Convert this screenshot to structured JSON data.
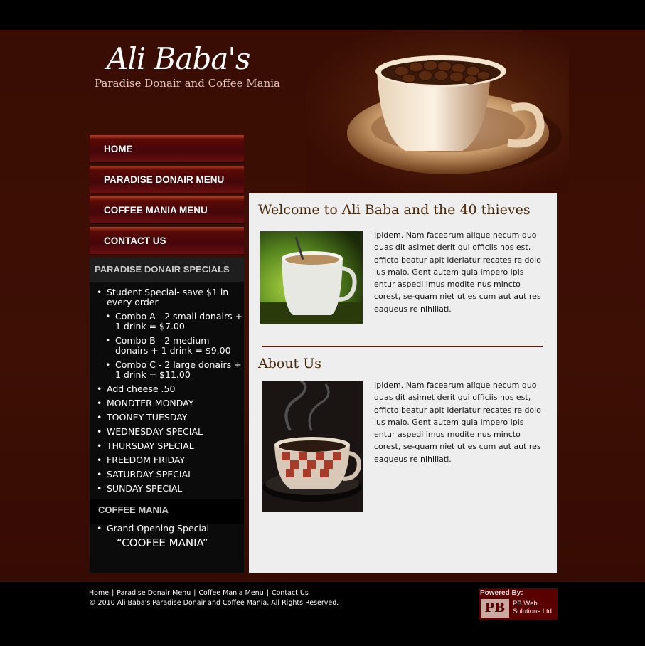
{
  "header": {
    "logo": "Ali Baba's",
    "tagline": "Paradise Donair and Coffee Mania"
  },
  "nav": {
    "items": [
      {
        "label": "HOME"
      },
      {
        "label": "PARADISE DONAIR MENU"
      },
      {
        "label": "COFFEE MANIA MENU"
      },
      {
        "label": "CONTACT US"
      }
    ]
  },
  "sidebar": {
    "donair_title": "PARADISE DONAIR SPECIALS",
    "specials": [
      "Student Special- save $1 in every order",
      "Combo A - 2 small donairs + 1 drink = $7.00",
      "Combo B - 2 medium donairs + 1 drink = $9.00",
      "Combo C - 2 large donairs + 1 drink = $11.00",
      "Add cheese .50",
      "MONDTER MONDAY",
      "TOONEY TUESDAY",
      "WEDNESDAY SPECIAL",
      "THURSDAY SPECIAL",
      "FREEDOM FRIDAY",
      "SATURDAY SPECIAL",
      "SUNDAY SPECIAL"
    ],
    "coffee_title": "COFFEE MANIA",
    "coffee_items": [
      "Grand Opening Special"
    ],
    "coffee_name": "“COOFEE MANIA”"
  },
  "content": {
    "welcome_title": "Welcome to Ali Baba and the 40 thieves",
    "welcome_text": "Ipidem. Nam facearum alique necum quo quas dit asimet derit qui officiis nos est, officto beatur apit ideriatur recates re dolo ius maio. Gent autem quia impero ipis entur aspedi imus modite nus mincto corest, se-quam niet ut es cum aut aut res eaqueus re nihiliati.",
    "about_title": "About Us",
    "about_text": "Ipidem. Nam facearum alique necum quo quas dit asimet derit qui officiis nos est, officto beatur apit ideriatur recates re dolo ius maio. Gent autem quia impero ipis entur aspedi imus modite nus mincto corest, se-quam niet ut es cum aut aut res eaqueus re nihiliati."
  },
  "footer": {
    "links": [
      "Home",
      "Paradise Donair Menu",
      "Coffee Mania Menu",
      "Contact Us"
    ],
    "separator": "|",
    "copyright": "© 2010 Ali Baba's Paradise Donair and Coffee Mania. All Rights Reserved.",
    "powered_by": "Powered By:",
    "powered_logo": "PB",
    "powered_name_1": "PB Web",
    "powered_name_2": "Solutions Ltd"
  },
  "colors": {
    "background": "#3a0d04",
    "nav_button": "#5a0a05",
    "content_bg": "#eeeeee",
    "heading": "#4a2a0a"
  }
}
